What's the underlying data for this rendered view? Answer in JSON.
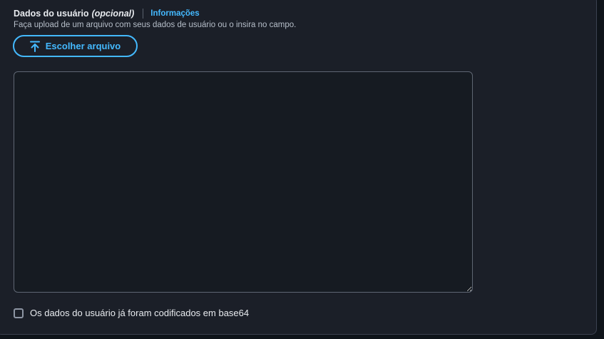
{
  "field": {
    "title": "Dados do usuário",
    "optional": "(opcional)",
    "info_link": "Informações",
    "description": "Faça upload de um arquivo com seus dados de usuário ou o insira no campo."
  },
  "upload_button": {
    "label": "Escolher arquivo",
    "icon": "upload-arrow-icon"
  },
  "user_data_textarea": {
    "value": "",
    "placeholder": ""
  },
  "base64_checkbox": {
    "label": "Os dados do usuário já foram codificados em base64",
    "checked": false
  },
  "colors": {
    "accent": "#44b9ff",
    "background": "#1b1f28",
    "border": "#5f6673"
  }
}
